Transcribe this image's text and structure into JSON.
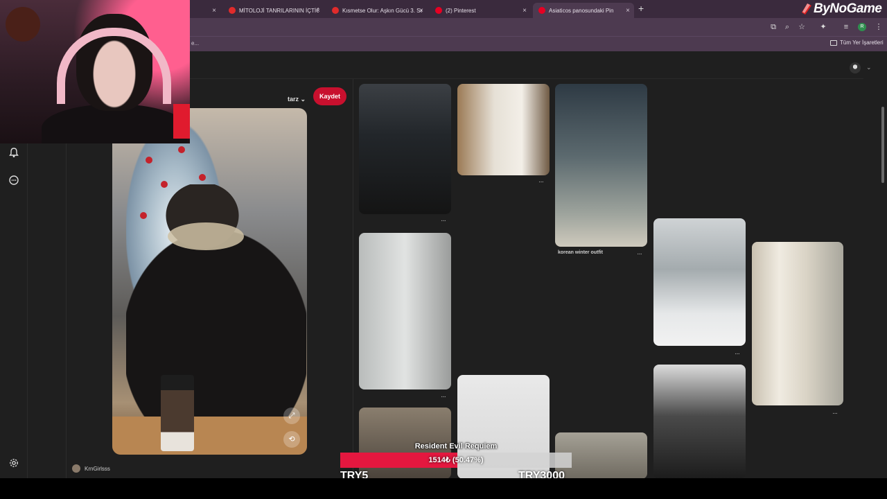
{
  "browser": {
    "tabs": [
      {
        "label": "",
        "favicon": "youtube-icon",
        "color": "#e02b2b",
        "active": false
      },
      {
        "label": "MİTOLOJİ TANRILARININ İÇTİĞİ",
        "favicon": "youtube-icon",
        "color": "#e02b2b",
        "active": false
      },
      {
        "label": "Kısmetse Olur: Aşkın Gücü 3. Se",
        "favicon": "youtube-icon",
        "color": "#e02b2b",
        "active": false
      },
      {
        "label": "(2) Pinterest",
        "favicon": "pinterest-icon",
        "color": "#e60023",
        "active": false
      },
      {
        "label": "Asiaticos panosundaki Pin",
        "favicon": "pinterest-icon",
        "color": "#e60023",
        "active": true
      }
    ],
    "new_tab": "+",
    "close_glyph": "×",
    "bookmarks_all_label": "Tüm Yer İşaretleri",
    "bookmarks_more": "e...",
    "profile_initial": "R"
  },
  "overlay_brand": "ByNoGame",
  "pinterest": {
    "board_name": "tarz",
    "save_label": "Kaydet",
    "pin_user": "KrnGirlsss",
    "pin_title": "korean winter outfit",
    "dots": "···"
  },
  "donation": {
    "title": "Resident Evil Requiem",
    "progress_text": "1514₺ (50.47%)",
    "progress_fraction": 0.5047,
    "min_label": "TRY5",
    "max_label": "TRY3000",
    "fill_color": "#e4173f"
  }
}
